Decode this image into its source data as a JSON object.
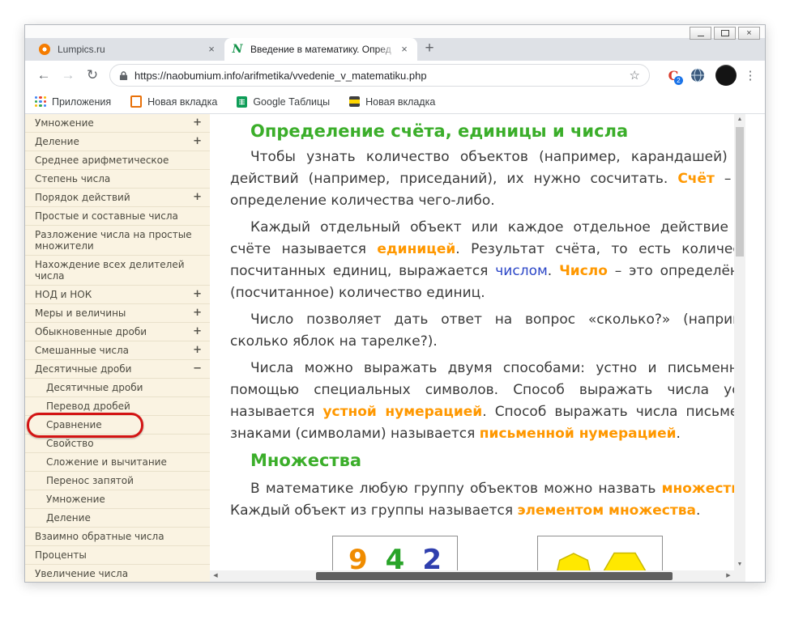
{
  "browser": {
    "tabs": [
      {
        "title": "Lumpics.ru"
      },
      {
        "title": "Введение в математику. Опред",
        "favicon_letter": "N"
      }
    ],
    "new_tab_button": "+",
    "tab_close": "×",
    "address": {
      "url": "https://naobumium.info/arifmetika/vvedenie_v_matematiku.php",
      "star": "☆"
    },
    "nav": {
      "back": "←",
      "forward": "→",
      "reload": "↻",
      "menu": "⋮"
    },
    "extensions": {
      "c_letter": "C",
      "c_badge": "2"
    },
    "bookmarks_bar": {
      "apps_label": "Приложения",
      "items": [
        "Новая вкладка",
        "Google Таблицы",
        "Новая вкладка"
      ]
    }
  },
  "sidebar": {
    "items": [
      {
        "label": "Умножение",
        "expander": "+"
      },
      {
        "label": "Деление",
        "expander": "+"
      },
      {
        "label": "Среднее арифметическое"
      },
      {
        "label": "Степень числа"
      },
      {
        "label": "Порядок действий",
        "expander": "+"
      },
      {
        "label": "Простые и составные числа"
      },
      {
        "label": "Разложение числа на простые множители"
      },
      {
        "label": "Нахождение всех делителей числа"
      },
      {
        "label": "НОД и НОК",
        "expander": "+"
      },
      {
        "label": "Меры и величины",
        "expander": "+"
      },
      {
        "label": "Обыкновенные дроби",
        "expander": "+"
      },
      {
        "label": "Смешанные числа",
        "expander": "+"
      },
      {
        "label": "Десятичные дроби",
        "expander": "−"
      },
      {
        "label": "Десятичные дроби",
        "sub": true
      },
      {
        "label": "Перевод дробей",
        "sub": true
      },
      {
        "label": "Сравнение",
        "sub": true,
        "highlighted": true
      },
      {
        "label": "Свойство",
        "sub": true
      },
      {
        "label": "Сложение и вычитание",
        "sub": true
      },
      {
        "label": "Перенос запятой",
        "sub": true
      },
      {
        "label": "Умножение",
        "sub": true
      },
      {
        "label": "Деление",
        "sub": true
      },
      {
        "label": "Взаимно обратные числа"
      },
      {
        "label": "Проценты"
      },
      {
        "label": "Увеличение числа"
      }
    ]
  },
  "content": {
    "heading1": "Определение счёта, единицы и числа",
    "paragraphs": {
      "p1": [
        {
          "t": "Чтобы узнать количество объектов (например, карандашей) или действий (например, приседаний), их нужно сосчитать. "
        },
        {
          "t": "Счёт",
          "s": "hl"
        },
        {
          "t": " – это определение количества чего-либо."
        }
      ],
      "p2": [
        {
          "t": "Каждый отдельный объект или каждое отдельное действие при счёте называется "
        },
        {
          "t": "единицей",
          "s": "hl"
        },
        {
          "t": ". Результат счёта, то есть количество посчитанных единиц, выражается "
        },
        {
          "t": "числом",
          "s": "lnk"
        },
        {
          "t": ". "
        },
        {
          "t": "Число",
          "s": "hl"
        },
        {
          "t": " – это определённое (посчитанное) количество единиц."
        }
      ],
      "p3": [
        {
          "t": "Число позволяет дать ответ на вопрос «сколько?» (например: сколько яблок на тарелке?)."
        }
      ],
      "p4": [
        {
          "t": "Числа можно выражать двумя способами: устно и письменно с помощью специальных символов. Способ выражать числа устно называется "
        },
        {
          "t": "устной нумерацией",
          "s": "hl"
        },
        {
          "t": ". Способ выражать числа письменно знаками (символами) называется "
        },
        {
          "t": "письменной нумерацией",
          "s": "hl"
        },
        {
          "t": "."
        }
      ],
      "p5": [
        {
          "t": "В математике любую группу объектов можно назвать "
        },
        {
          "t": "множеством",
          "s": "hl"
        },
        {
          "t": ". Каждый объект из группы называется "
        },
        {
          "t": "элементом множества",
          "s": "hl"
        },
        {
          "t": "."
        }
      ]
    },
    "heading2": "Множества",
    "figures": {
      "digits": [
        "9",
        "4",
        "2"
      ]
    }
  },
  "colors": {
    "heading_green": "#3bae2a",
    "highlight_orange": "#ff9800",
    "link_blue": "#2b46c7",
    "annotation_red": "#d31414",
    "sidebar_bg": "#faf3e2",
    "tabstrip_bg": "#dee1e6"
  }
}
